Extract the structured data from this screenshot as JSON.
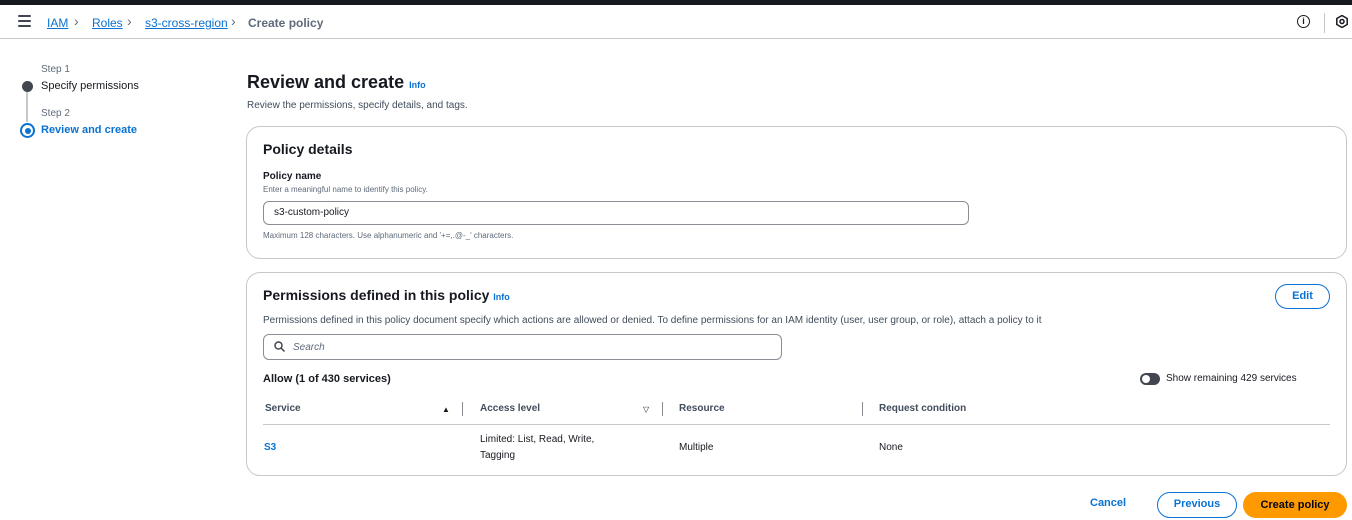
{
  "breadcrumb": {
    "items": [
      "IAM",
      "Roles",
      "s3-cross-region",
      "Create policy"
    ]
  },
  "steps": [
    {
      "label": "Step 1",
      "title": "Specify permissions"
    },
    {
      "label": "Step 2",
      "title": "Review and create"
    }
  ],
  "header": {
    "title": "Review and create",
    "info": "Info",
    "subtitle": "Review the permissions, specify details, and tags."
  },
  "policy_details": {
    "title": "Policy details",
    "name_label": "Policy name",
    "name_desc": "Enter a meaningful name to identify this policy.",
    "name_value": "s3-custom-policy",
    "name_constraint": "Maximum 128 characters. Use alphanumeric and '+=,.@-_' characters."
  },
  "permissions": {
    "title": "Permissions defined in this policy",
    "info": "Info",
    "edit_label": "Edit",
    "description": "Permissions defined in this policy document specify which actions are allowed or denied. To define permissions for an IAM identity (user, user group, or role), attach a policy to it",
    "search_placeholder": "Search",
    "allow_title": "Allow (1 of 430 services)",
    "toggle_label": "Show remaining 429 services",
    "columns": [
      "Service",
      "Access level",
      "Resource",
      "Request condition"
    ],
    "rows": [
      {
        "service": "S3",
        "access_level_1": "Limited: List, Read, Write,",
        "access_level_2": "Tagging",
        "resource": "Multiple",
        "condition": "None"
      }
    ]
  },
  "footer": {
    "cancel": "Cancel",
    "previous": "Previous",
    "create": "Create policy"
  },
  "colors": {
    "link": "#0972d3",
    "primary_button": "#ff9900",
    "text": "#16191f"
  },
  "icons": [
    "menu-icon",
    "chevron-right-icon",
    "info-circle-icon",
    "settings-icon",
    "search-icon",
    "sort-ascending-icon",
    "sort-descending-icon"
  ]
}
